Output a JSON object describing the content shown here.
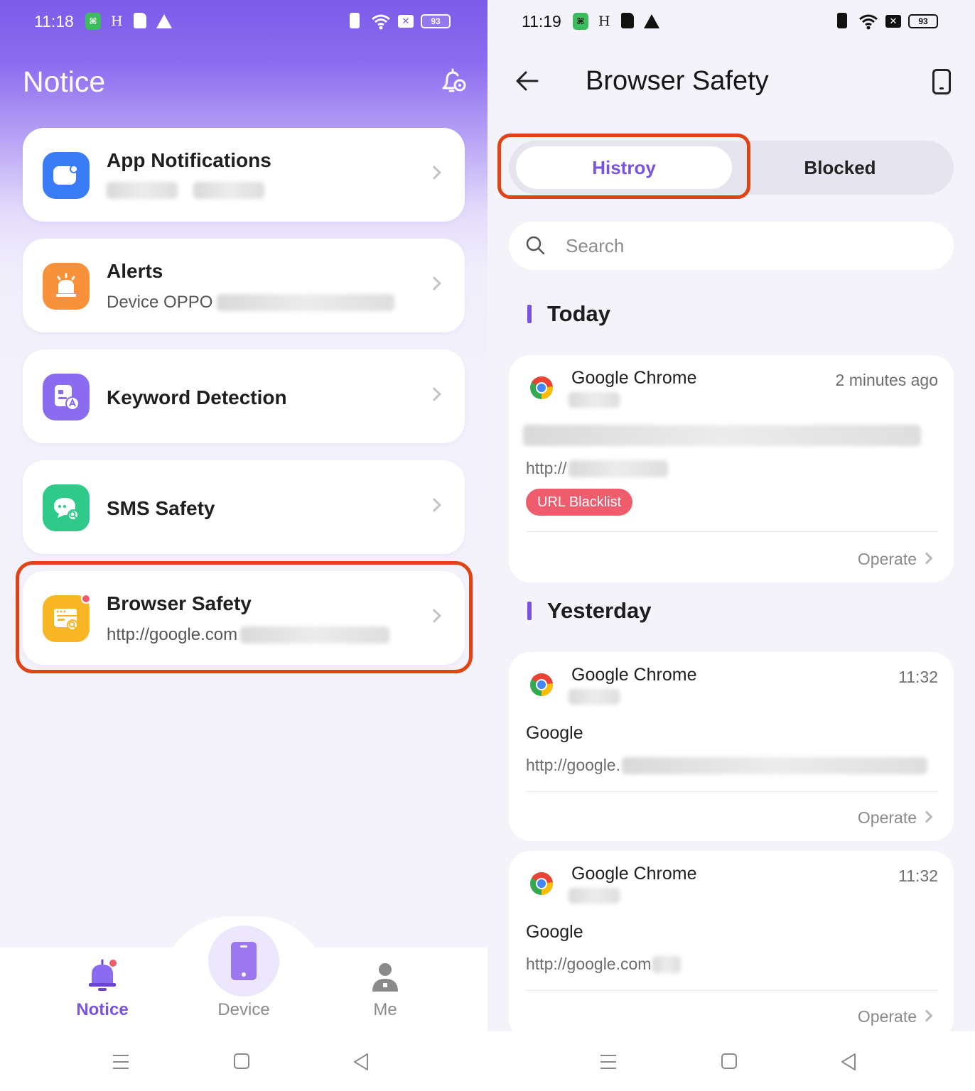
{
  "left": {
    "status": {
      "time": "11:18",
      "battery": "93"
    },
    "title": "Notice",
    "cards": [
      {
        "title": "App Notifications",
        "subtitle": ""
      },
      {
        "title": "Alerts",
        "subtitle": "Device OPPO"
      },
      {
        "title": "Keyword Detection",
        "subtitle": ""
      },
      {
        "title": "SMS Safety",
        "subtitle": ""
      },
      {
        "title": "Browser Safety",
        "subtitle": "http://google.com"
      }
    ],
    "tabs": [
      {
        "label": "Notice",
        "active": true
      },
      {
        "label": "Device",
        "active": false
      },
      {
        "label": "Me",
        "active": false
      }
    ]
  },
  "right": {
    "status": {
      "time": "11:19",
      "battery": "93"
    },
    "title": "Browser Safety",
    "segments": {
      "history": "Histroy",
      "blocked": "Blocked"
    },
    "search": {
      "placeholder": "Search"
    },
    "sections": {
      "today": "Today",
      "yesterday": "Yesterday"
    },
    "records": [
      {
        "app": "Google Chrome",
        "time": "2 minutes ago",
        "title": "",
        "url": "http://",
        "tag": "URL Blacklist",
        "operate": "Operate"
      },
      {
        "app": "Google Chrome",
        "time": "11:32",
        "title": "Google",
        "url": "http://google.",
        "operate": "Operate"
      },
      {
        "app": "Google Chrome",
        "time": "11:32",
        "title": "Google",
        "url": "http://google.com",
        "operate": "Operate"
      }
    ]
  },
  "colors": {
    "accent": "#7a52e0",
    "highlight_frame": "#e04314",
    "tag_red": "#ef5d6d",
    "app_notif_blue": "#3a7cf5",
    "alerts_orange": "#f7923a",
    "keyword_purple": "#8b6cf0",
    "sms_green": "#2fc98a",
    "browser_yellow": "#f8b524"
  },
  "icons": [
    "settings-bell-icon",
    "back-arrow-icon",
    "device-icon",
    "search-icon",
    "chrome-icon",
    "chevron-right-icon"
  ]
}
